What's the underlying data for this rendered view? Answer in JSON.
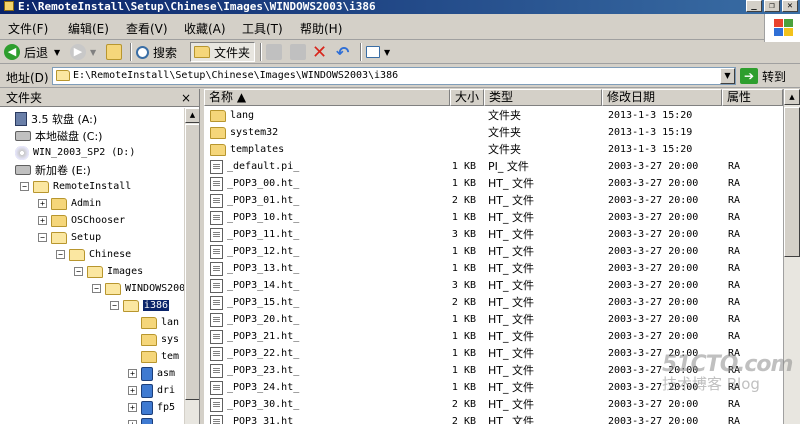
{
  "window": {
    "title": "E:\\RemoteInstall\\Setup\\Chinese\\Images\\WINDOWS2003\\i386",
    "buttons": [
      "_",
      "❐",
      "✕"
    ]
  },
  "menu": [
    "文件(F)",
    "编辑(E)",
    "查看(V)",
    "收藏(A)",
    "工具(T)",
    "帮助(H)"
  ],
  "toolbar": {
    "back_label": "后退",
    "search_label": "搜索",
    "folders_label": "文件夹"
  },
  "address": {
    "label": "地址(D)",
    "value": "E:\\RemoteInstall\\Setup\\Chinese\\Images\\WINDOWS2003\\i386",
    "go_label": "转到"
  },
  "folders_pane": {
    "title": "文件夹",
    "close": "×",
    "items": [
      {
        "label": "3.5 软盘 (A:)",
        "icon": "floppy-icon"
      },
      {
        "label": "本地磁盘 (C:)",
        "icon": "drive-icon"
      },
      {
        "label": "WIN_2003_SP2 (D:)",
        "icon": "cd-icon"
      },
      {
        "label": "新加卷 (E:)",
        "icon": "drive-icon"
      },
      {
        "label": "RemoteInstall",
        "icon": "folder-open-icon",
        "expander": "−"
      },
      {
        "label": "Admin",
        "icon": "folder-icon",
        "expander": "+"
      },
      {
        "label": "OSChooser",
        "icon": "folder-icon",
        "expander": "+"
      },
      {
        "label": "Setup",
        "icon": "folder-open-icon",
        "expander": "−"
      },
      {
        "label": "Chinese",
        "icon": "folder-open-icon",
        "expander": "−"
      },
      {
        "label": "Images",
        "icon": "folder-open-icon",
        "expander": "−"
      },
      {
        "label": "WINDOWS200",
        "icon": "folder-open-icon",
        "expander": "−"
      },
      {
        "label": "i386",
        "icon": "folder-open-icon",
        "expander": "−",
        "selected": true
      },
      {
        "label": "lan",
        "icon": "folder-icon"
      },
      {
        "label": "sys",
        "icon": "folder-icon"
      },
      {
        "label": "tem",
        "icon": "folder-icon"
      },
      {
        "label": "asm",
        "icon": "package-icon",
        "expander": "+"
      },
      {
        "label": "dri",
        "icon": "package-icon",
        "expander": "+"
      },
      {
        "label": "fp5",
        "icon": "package-icon",
        "expander": "+"
      },
      {
        "label": "",
        "icon": "package-icon",
        "expander": "+"
      }
    ]
  },
  "file_list": {
    "columns": [
      "名称 ▲",
      "大小",
      "类型",
      "修改日期",
      "属性"
    ],
    "rows": [
      {
        "name": "lang",
        "size": "",
        "type": "文件夹",
        "date": "2013-1-3 15:20",
        "attr": "",
        "icon": "folder-icon"
      },
      {
        "name": "system32",
        "size": "",
        "type": "文件夹",
        "date": "2013-1-3 15:19",
        "attr": "",
        "icon": "folder-icon"
      },
      {
        "name": "templates",
        "size": "",
        "type": "文件夹",
        "date": "2013-1-3 15:20",
        "attr": "",
        "icon": "folder-icon"
      },
      {
        "name": "_default.pi_",
        "size": "1 KB",
        "type": "PI_ 文件",
        "date": "2003-3-27 20:00",
        "attr": "RA",
        "icon": "file-icon"
      },
      {
        "name": "_POP3_00.ht_",
        "size": "1 KB",
        "type": "HT_ 文件",
        "date": "2003-3-27 20:00",
        "attr": "RA",
        "icon": "file-icon"
      },
      {
        "name": "_POP3_01.ht_",
        "size": "2 KB",
        "type": "HT_ 文件",
        "date": "2003-3-27 20:00",
        "attr": "RA",
        "icon": "file-icon"
      },
      {
        "name": "_POP3_10.ht_",
        "size": "1 KB",
        "type": "HT_ 文件",
        "date": "2003-3-27 20:00",
        "attr": "RA",
        "icon": "file-icon"
      },
      {
        "name": "_POP3_11.ht_",
        "size": "3 KB",
        "type": "HT_ 文件",
        "date": "2003-3-27 20:00",
        "attr": "RA",
        "icon": "file-icon"
      },
      {
        "name": "_POP3_12.ht_",
        "size": "1 KB",
        "type": "HT_ 文件",
        "date": "2003-3-27 20:00",
        "attr": "RA",
        "icon": "file-icon"
      },
      {
        "name": "_POP3_13.ht_",
        "size": "1 KB",
        "type": "HT_ 文件",
        "date": "2003-3-27 20:00",
        "attr": "RA",
        "icon": "file-icon"
      },
      {
        "name": "_POP3_14.ht_",
        "size": "3 KB",
        "type": "HT_ 文件",
        "date": "2003-3-27 20:00",
        "attr": "RA",
        "icon": "file-icon"
      },
      {
        "name": "_POP3_15.ht_",
        "size": "2 KB",
        "type": "HT_ 文件",
        "date": "2003-3-27 20:00",
        "attr": "RA",
        "icon": "file-icon"
      },
      {
        "name": "_POP3_20.ht_",
        "size": "1 KB",
        "type": "HT_ 文件",
        "date": "2003-3-27 20:00",
        "attr": "RA",
        "icon": "file-icon"
      },
      {
        "name": "_POP3_21.ht_",
        "size": "1 KB",
        "type": "HT_ 文件",
        "date": "2003-3-27 20:00",
        "attr": "RA",
        "icon": "file-icon"
      },
      {
        "name": "_POP3_22.ht_",
        "size": "1 KB",
        "type": "HT_ 文件",
        "date": "2003-3-27 20:00",
        "attr": "RA",
        "icon": "file-icon"
      },
      {
        "name": "_POP3_23.ht_",
        "size": "1 KB",
        "type": "HT_ 文件",
        "date": "2003-3-27 20:00",
        "attr": "RA",
        "icon": "file-icon"
      },
      {
        "name": "_POP3_24.ht_",
        "size": "1 KB",
        "type": "HT_ 文件",
        "date": "2003-3-27 20:00",
        "attr": "RA",
        "icon": "file-icon"
      },
      {
        "name": "_POP3_30.ht_",
        "size": "2 KB",
        "type": "HT_ 文件",
        "date": "2003-3-27 20:00",
        "attr": "RA",
        "icon": "file-icon"
      },
      {
        "name": "_POP3_31.ht_",
        "size": "2 KB",
        "type": "HT_ 文件",
        "date": "2003-3-27 20:00",
        "attr": "RA",
        "icon": "file-icon"
      }
    ]
  },
  "watermark": {
    "line1": "51CTO.com",
    "line2": "技术博客 Blog"
  },
  "colors": {
    "titlebar": "#0a246a",
    "selection": "#0a246a",
    "folder": "#f5d67a"
  }
}
